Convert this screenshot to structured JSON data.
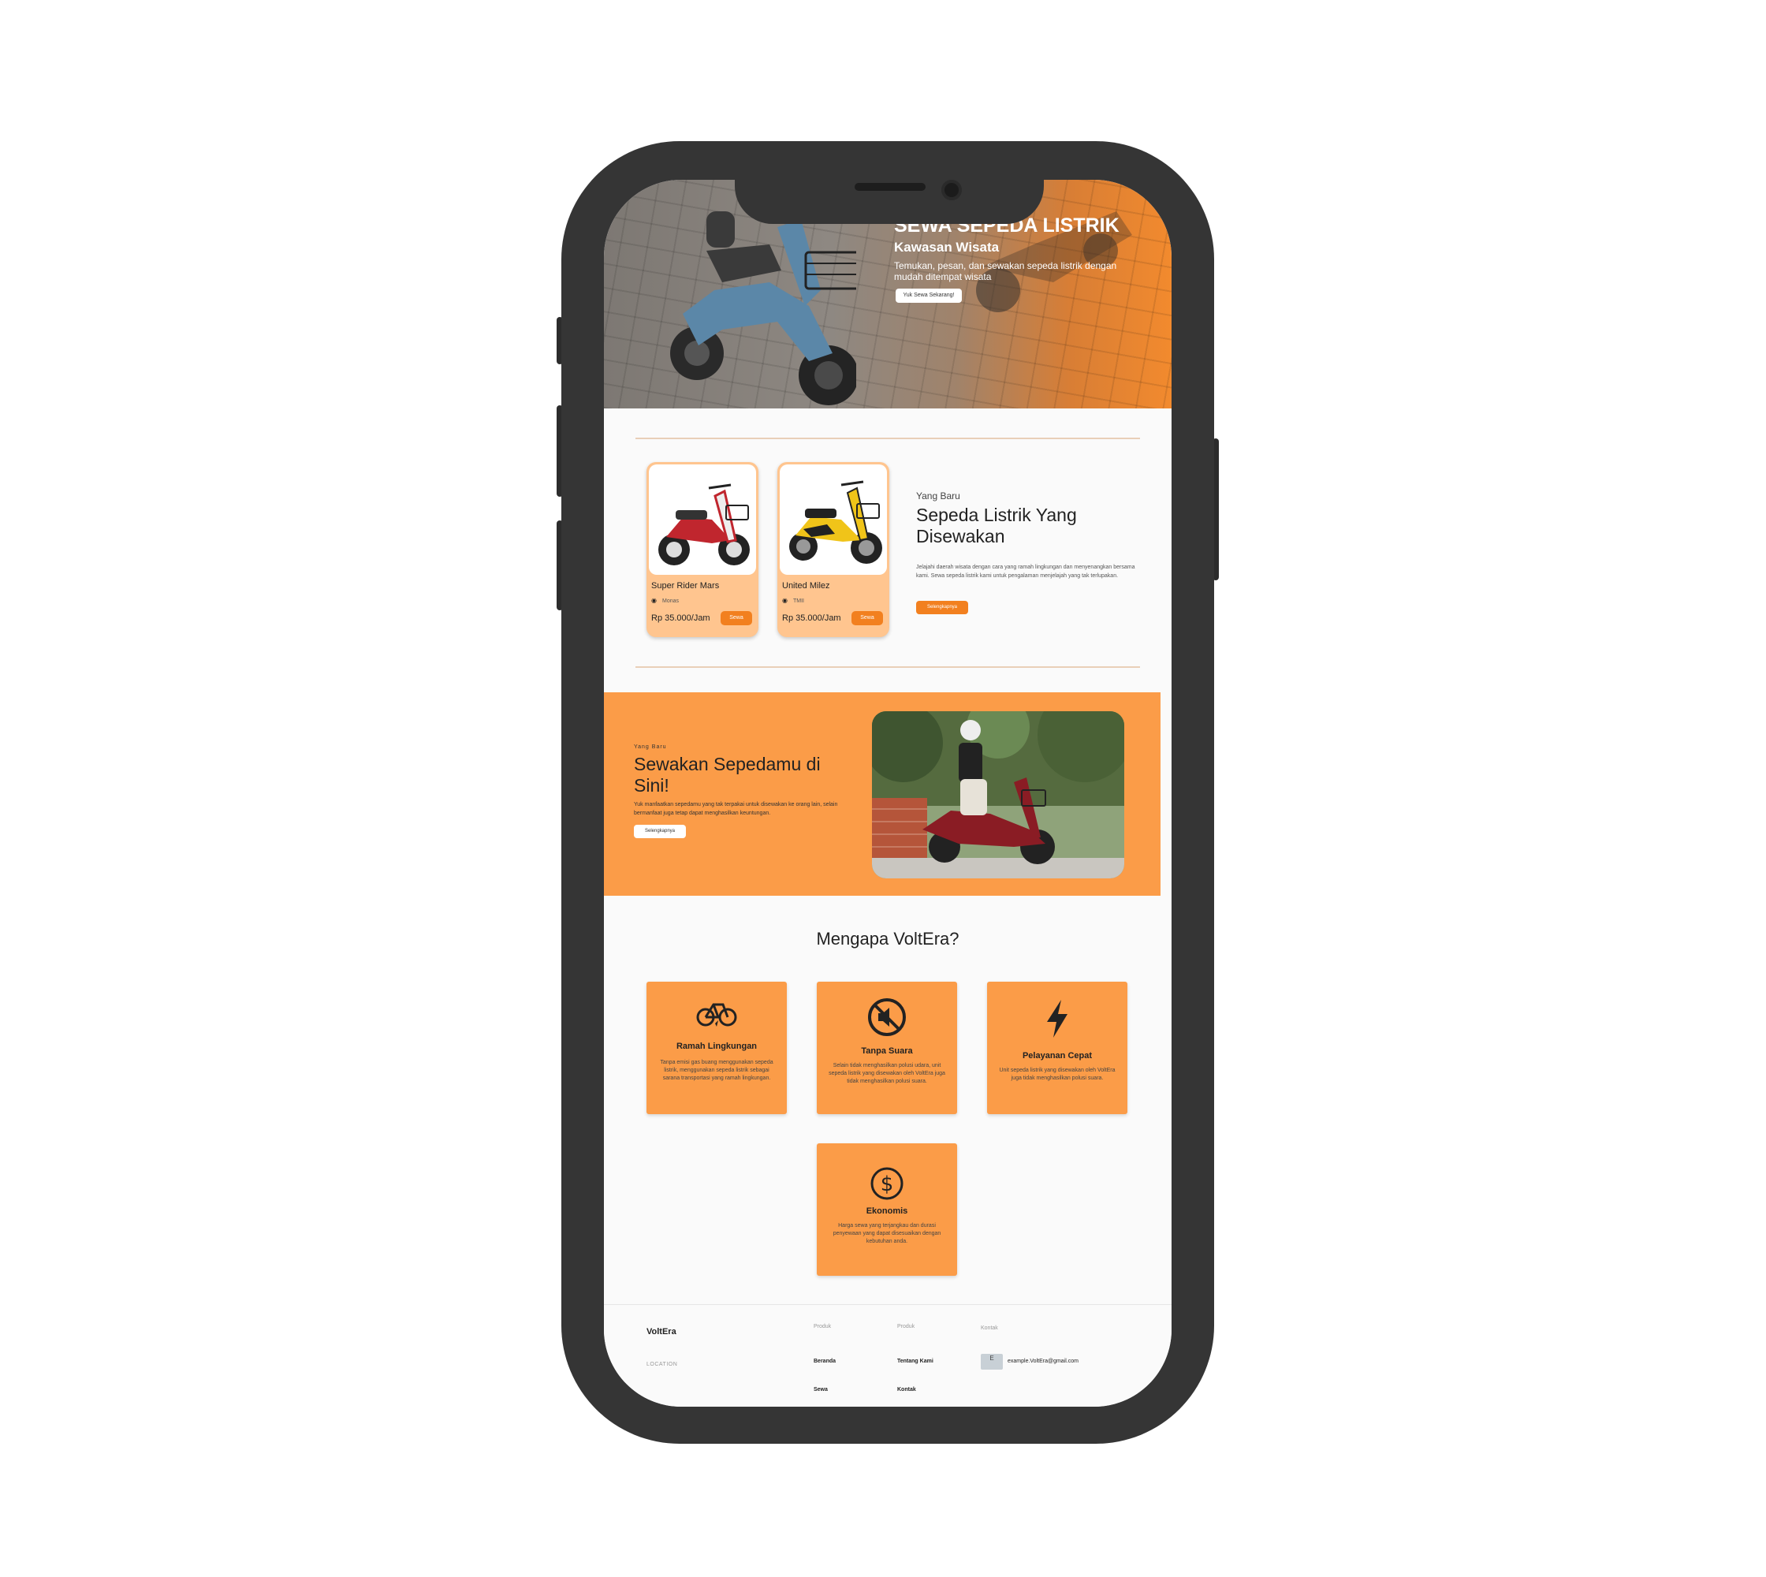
{
  "hero": {
    "title": "SEWA SEPEDA LISTRIK",
    "subtitle": "Kawasan Wisata",
    "description": "Temukan, pesan, dan sewakan sepeda listrik dengan mudah ditempat wisata",
    "cta_label": "Yuk Sewa Sekarang!"
  },
  "rentals": {
    "kicker": "Yang Baru",
    "title": "Sepeda Listrik Yang Disewakan",
    "description": "Jelajahi daerah wisata dengan cara yang ramah lingkungan dan menyenangkan bersama kami. Sewa sepeda listrik kami untuk pengalaman menjelajah yang tak terlupakan.",
    "more_label": "Selengkapnya",
    "cards": [
      {
        "name": "Super Rider Mars",
        "location": "Monas",
        "price": "Rp 35.000/Jam",
        "button": "Sewa",
        "bike_color": "#c0262e"
      },
      {
        "name": "United Milez",
        "location": "TMII",
        "price": "Rp 35.000/Jam",
        "button": "Sewa",
        "bike_color": "#f0c419"
      }
    ]
  },
  "promo": {
    "kicker": "Yang Baru",
    "title": "Sewakan Sepedamu di Sini!",
    "description": "Yuk manfaatkan sepedamu yang tak terpakai untuk disewakan ke orang lain, selain bermanfaat juga tetap dapat menghasilkan keuntungan.",
    "button": "Selengkapnya"
  },
  "why": {
    "title": "Mengapa VoltEra?",
    "features": [
      {
        "icon": "bicycle-icon",
        "title": "Ramah Lingkungan",
        "description": "Tanpa emisi gas buang menggunakan sepeda listrik, menggunakan sepeda listrik sebagai sarana transportasi yang ramah lingkungan."
      },
      {
        "icon": "mute-icon",
        "title": "Tanpa Suara",
        "description": "Selain tidak menghasilkan polusi udara, unit sepeda listrik yang disewakan oleh VoltEra juga tidak menghasilkan polusi suara."
      },
      {
        "icon": "lightning-icon",
        "title": "Pelayanan Cepat",
        "description": "Unit sepeda listrik yang disewakan oleh VoltEra juga tidak menghasilkan polusi suara."
      },
      {
        "icon": "dollar-icon",
        "title": "Ekonomis",
        "description": "Harga sewa yang terjangkau dan durasi penyewaan yang dapat disesuaikan dengan kebutuhan anda."
      }
    ]
  },
  "footer": {
    "brand": "VoltEra",
    "location": "LOCATION",
    "col1": {
      "heading": "Produk",
      "links": [
        "Beranda",
        "Sewa"
      ]
    },
    "col2": {
      "heading": "Produk",
      "links": [
        "Tentang Kami",
        "Kontak"
      ]
    },
    "contact": {
      "heading": "Kontak",
      "icon_letter": "E",
      "email": "example.VoltEra@gmail.com"
    }
  },
  "colors": {
    "accent": "#f2801f",
    "banner": "#fb9c48",
    "card": "#ffc58f",
    "frame": "#353535"
  }
}
